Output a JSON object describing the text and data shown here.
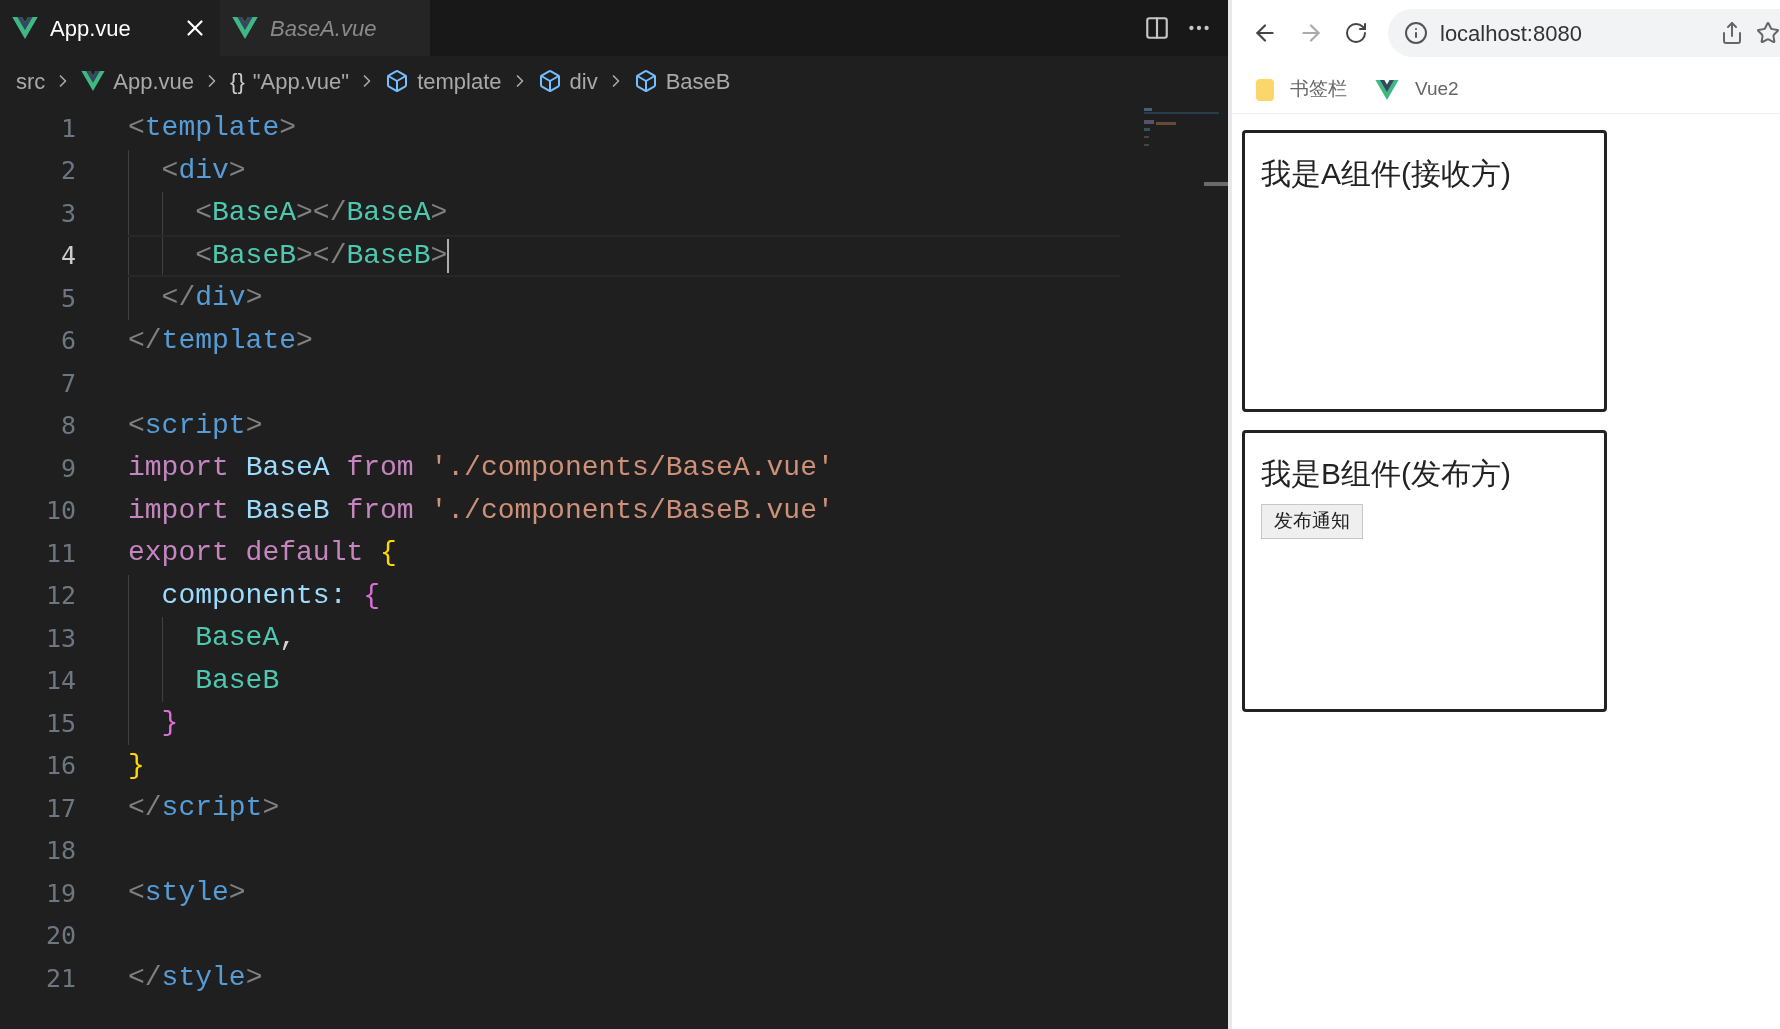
{
  "editor": {
    "tabs": [
      {
        "label": "App.vue",
        "selected": true,
        "preview": false
      },
      {
        "label": "BaseA.vue",
        "selected": false,
        "preview": true
      }
    ],
    "breadcrumbs": [
      {
        "label": "src",
        "kind": "folder"
      },
      {
        "label": "App.vue",
        "kind": "vue"
      },
      {
        "label": "\"App.vue\"",
        "kind": "object",
        "symbol": "{}"
      },
      {
        "label": "template",
        "kind": "element"
      },
      {
        "label": "div",
        "kind": "element"
      },
      {
        "label": "BaseB",
        "kind": "element"
      }
    ],
    "lines": [
      {
        "number": "1",
        "current": false,
        "tokens": [
          {
            "text": "<",
            "kind": "punct"
          },
          {
            "text": "template",
            "kind": "tag"
          },
          {
            "text": ">",
            "kind": "punct"
          }
        ]
      },
      {
        "number": "2",
        "current": false,
        "tokens": [
          {
            "text": "  <",
            "kind": "punct"
          },
          {
            "text": "div",
            "kind": "tag"
          },
          {
            "text": ">",
            "kind": "punct"
          }
        ]
      },
      {
        "number": "3",
        "current": false,
        "tokens": [
          {
            "text": "    <",
            "kind": "punct"
          },
          {
            "text": "BaseA",
            "kind": "component"
          },
          {
            "text": "></",
            "kind": "punct"
          },
          {
            "text": "BaseA",
            "kind": "component"
          },
          {
            "text": ">",
            "kind": "punct"
          }
        ]
      },
      {
        "number": "4",
        "current": true,
        "tokens": [
          {
            "text": "    <",
            "kind": "punct"
          },
          {
            "text": "BaseB",
            "kind": "component"
          },
          {
            "text": "></",
            "kind": "punct"
          },
          {
            "text": "BaseB",
            "kind": "component"
          },
          {
            "text": ">",
            "kind": "punct"
          }
        ]
      },
      {
        "number": "5",
        "current": false,
        "tokens": [
          {
            "text": "  </",
            "kind": "punct"
          },
          {
            "text": "div",
            "kind": "tag"
          },
          {
            "text": ">",
            "kind": "punct"
          }
        ]
      },
      {
        "number": "6",
        "current": false,
        "tokens": [
          {
            "text": "</",
            "kind": "punct"
          },
          {
            "text": "template",
            "kind": "tag"
          },
          {
            "text": ">",
            "kind": "punct"
          }
        ]
      },
      {
        "number": "7",
        "current": false
      },
      {
        "number": "8",
        "current": false,
        "tokens": [
          {
            "text": "<",
            "kind": "punct"
          },
          {
            "text": "script",
            "kind": "tag"
          },
          {
            "text": ">",
            "kind": "punct"
          }
        ]
      },
      {
        "number": "9",
        "current": false,
        "tokens": [
          {
            "text": "import",
            "kind": "keyword"
          },
          {
            "text": " BaseA ",
            "kind": "ident"
          },
          {
            "text": "from",
            "kind": "keyword"
          },
          {
            "text": " './components/BaseA.vue'",
            "kind": "string"
          }
        ]
      },
      {
        "number": "10",
        "current": false,
        "tokens": [
          {
            "text": "import",
            "kind": "keyword"
          },
          {
            "text": " BaseB ",
            "kind": "ident"
          },
          {
            "text": "from",
            "kind": "keyword"
          },
          {
            "text": " './components/BaseB.vue'",
            "kind": "string"
          }
        ]
      },
      {
        "number": "11",
        "current": false,
        "tokens": [
          {
            "text": "export default",
            "kind": "keyword"
          },
          {
            "text": " {",
            "kind": "bracket1"
          }
        ]
      },
      {
        "number": "12",
        "current": false,
        "tokens": [
          {
            "text": "  components: ",
            "kind": "ident"
          },
          {
            "text": "{",
            "kind": "bracket2"
          }
        ]
      },
      {
        "number": "13",
        "current": false,
        "tokens": [
          {
            "text": "    BaseA",
            "kind": "component"
          },
          {
            "text": ",",
            "kind": "plain"
          }
        ]
      },
      {
        "number": "14",
        "current": false,
        "tokens": [
          {
            "text": "    BaseB",
            "kind": "component"
          }
        ]
      },
      {
        "number": "15",
        "current": false,
        "tokens": [
          {
            "text": "  }",
            "kind": "bracket2"
          }
        ]
      },
      {
        "number": "16",
        "current": false,
        "tokens": [
          {
            "text": "}",
            "kind": "bracket1"
          }
        ]
      },
      {
        "number": "17",
        "current": false,
        "tokens": [
          {
            "text": "</",
            "kind": "punct"
          },
          {
            "text": "script",
            "kind": "tag"
          },
          {
            "text": ">",
            "kind": "punct"
          }
        ]
      },
      {
        "number": "18",
        "current": false
      },
      {
        "number": "19",
        "current": false,
        "tokens": [
          {
            "text": "<",
            "kind": "punct"
          },
          {
            "text": "style",
            "kind": "tag"
          },
          {
            "text": ">",
            "kind": "punct"
          }
        ]
      },
      {
        "number": "20",
        "current": false
      },
      {
        "number": "21",
        "current": false,
        "tokens": [
          {
            "text": "</",
            "kind": "punct"
          },
          {
            "text": "style",
            "kind": "tag"
          },
          {
            "text": ">",
            "kind": "punct"
          }
        ]
      }
    ]
  },
  "browser": {
    "address": "localhost:8080",
    "bookmarks": [
      {
        "label": "书签栏",
        "kind": "folder"
      },
      {
        "label": "Vue2",
        "kind": "vue"
      }
    ],
    "cards": [
      {
        "title": "我是A组件(接收方)"
      },
      {
        "title": "我是B组件(发布方)",
        "button": "发布通知"
      }
    ]
  }
}
